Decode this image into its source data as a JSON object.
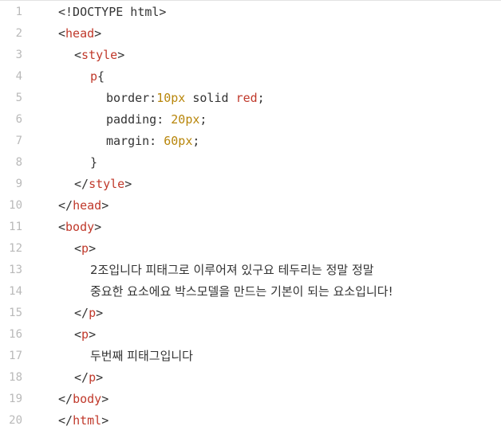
{
  "editor": {
    "lines": [
      {
        "n": "1",
        "indent": 0,
        "parts": [
          {
            "t": "<!DOCTYPE html>",
            "c": "br"
          }
        ]
      },
      {
        "n": "2",
        "indent": 0,
        "parts": [
          {
            "t": "<",
            "c": "br"
          },
          {
            "t": "head",
            "c": "tag"
          },
          {
            "t": ">",
            "c": "br"
          }
        ]
      },
      {
        "n": "3",
        "indent": 1,
        "parts": [
          {
            "t": "<",
            "c": "br"
          },
          {
            "t": "style",
            "c": "tag"
          },
          {
            "t": ">",
            "c": "br"
          }
        ]
      },
      {
        "n": "4",
        "indent": 2,
        "parts": [
          {
            "t": "p",
            "c": "tag"
          },
          {
            "t": "{",
            "c": "br"
          }
        ]
      },
      {
        "n": "5",
        "indent": 3,
        "parts": [
          {
            "t": "border:",
            "c": "br"
          },
          {
            "t": "10px",
            "c": "num-lit"
          },
          {
            "t": " solid ",
            "c": "br"
          },
          {
            "t": "red",
            "c": "val-red"
          },
          {
            "t": ";",
            "c": "br"
          }
        ]
      },
      {
        "n": "6",
        "indent": 3,
        "parts": [
          {
            "t": "padding: ",
            "c": "br"
          },
          {
            "t": "20px",
            "c": "num-lit"
          },
          {
            "t": ";",
            "c": "br"
          }
        ]
      },
      {
        "n": "7",
        "indent": 3,
        "parts": [
          {
            "t": "margin: ",
            "c": "br"
          },
          {
            "t": "60px",
            "c": "num-lit"
          },
          {
            "t": ";",
            "c": "br"
          }
        ]
      },
      {
        "n": "8",
        "indent": 2,
        "parts": [
          {
            "t": "}",
            "c": "br"
          }
        ]
      },
      {
        "n": "9",
        "indent": 1,
        "parts": [
          {
            "t": "</",
            "c": "br"
          },
          {
            "t": "style",
            "c": "tag"
          },
          {
            "t": ">",
            "c": "br"
          }
        ]
      },
      {
        "n": "10",
        "indent": 0,
        "parts": [
          {
            "t": "</",
            "c": "br"
          },
          {
            "t": "head",
            "c": "tag"
          },
          {
            "t": ">",
            "c": "br"
          }
        ]
      },
      {
        "n": "11",
        "indent": 0,
        "parts": [
          {
            "t": "<",
            "c": "br"
          },
          {
            "t": "body",
            "c": "tag"
          },
          {
            "t": ">",
            "c": "br"
          }
        ]
      },
      {
        "n": "12",
        "indent": 1,
        "parts": [
          {
            "t": "<",
            "c": "br"
          },
          {
            "t": "p",
            "c": "tag"
          },
          {
            "t": ">",
            "c": "br"
          }
        ]
      },
      {
        "n": "13",
        "indent": 2,
        "parts": [
          {
            "t": "2조입니다 피태그로 이루어져 있구요 테두리는 정말 정말",
            "c": "text"
          }
        ]
      },
      {
        "n": "14",
        "indent": 2,
        "parts": [
          {
            "t": "중요한 요소에요 박스모델을 만드는 기본이 되는 요소입니다!",
            "c": "text"
          }
        ]
      },
      {
        "n": "15",
        "indent": 1,
        "parts": [
          {
            "t": "</",
            "c": "br"
          },
          {
            "t": "p",
            "c": "tag"
          },
          {
            "t": ">",
            "c": "br"
          }
        ]
      },
      {
        "n": "16",
        "indent": 1,
        "parts": [
          {
            "t": "<",
            "c": "br"
          },
          {
            "t": "p",
            "c": "tag"
          },
          {
            "t": ">",
            "c": "br"
          }
        ]
      },
      {
        "n": "17",
        "indent": 2,
        "parts": [
          {
            "t": "두번째 피태그입니다",
            "c": "text"
          }
        ]
      },
      {
        "n": "18",
        "indent": 1,
        "parts": [
          {
            "t": "</",
            "c": "br"
          },
          {
            "t": "p",
            "c": "tag"
          },
          {
            "t": ">",
            "c": "br"
          }
        ]
      },
      {
        "n": "19",
        "indent": 0,
        "parts": [
          {
            "t": "</",
            "c": "br"
          },
          {
            "t": "body",
            "c": "tag"
          },
          {
            "t": ">",
            "c": "br"
          }
        ]
      },
      {
        "n": "20",
        "indent": 0,
        "parts": [
          {
            "t": "</",
            "c": "br"
          },
          {
            "t": "html",
            "c": "tag"
          },
          {
            "t": ">",
            "c": "br"
          }
        ]
      }
    ]
  }
}
